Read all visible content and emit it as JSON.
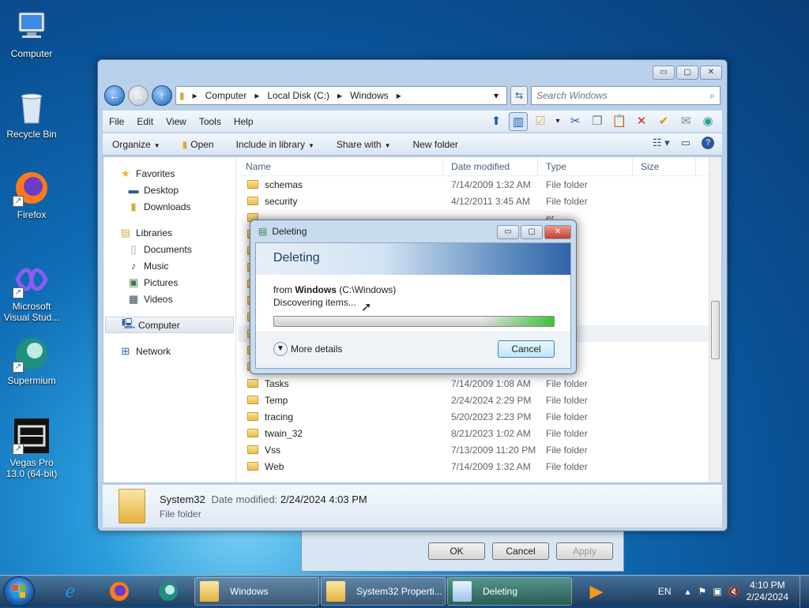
{
  "desktop": {
    "icons": [
      {
        "label": "Computer"
      },
      {
        "label": "Recycle Bin"
      },
      {
        "label": "Firefox"
      },
      {
        "label": "Microsoft Visual Stud..."
      },
      {
        "label": "Supermium"
      },
      {
        "label": "Vegas Pro 13.0 (64-bit)"
      }
    ]
  },
  "explorer": {
    "address": [
      "Computer",
      "Local Disk (C:)",
      "Windows"
    ],
    "search_placeholder": "Search Windows",
    "menu": [
      "File",
      "Edit",
      "View",
      "Tools",
      "Help"
    ],
    "commands": [
      "Organize",
      "Open",
      "Include in library",
      "Share with",
      "New folder"
    ],
    "nav": {
      "favorites": "Favorites",
      "fav_items": [
        "Desktop",
        "Downloads"
      ],
      "libraries": "Libraries",
      "lib_items": [
        "Documents",
        "Music",
        "Pictures",
        "Videos"
      ],
      "computer": "Computer",
      "network": "Network"
    },
    "columns": [
      "Name",
      "Date modified",
      "Type",
      "Size"
    ],
    "rows_top": [
      {
        "name": "schemas",
        "date": "7/14/2009 1:32 AM",
        "type": "File folder"
      },
      {
        "name": "security",
        "date": "4/12/2011 3:45 AM",
        "type": "File folder"
      }
    ],
    "rows_bottom": [
      {
        "name": "Tasks",
        "date": "7/14/2009 1:08 AM",
        "type": "File folder"
      },
      {
        "name": "Temp",
        "date": "2/24/2024 2:29 PM",
        "type": "File folder"
      },
      {
        "name": "tracing",
        "date": "5/20/2023 2:23 PM",
        "type": "File folder"
      },
      {
        "name": "twain_32",
        "date": "8/21/2023 1:02 AM",
        "type": "File folder"
      },
      {
        "name": "Vss",
        "date": "7/13/2009 11:20 PM",
        "type": "File folder"
      },
      {
        "name": "Web",
        "date": "7/14/2009 1:32 AM",
        "type": "File folder"
      }
    ],
    "hidden_type_col": "er",
    "details": {
      "name": "System32",
      "date_label": "Date modified:",
      "date": "2/24/2024 4:03 PM",
      "type": "File folder"
    }
  },
  "dialog": {
    "title": "Deleting",
    "heading": "Deleting",
    "from_label": "from",
    "from_bold": "Windows",
    "from_path": "(C:\\Windows)",
    "status": "Discovering items...",
    "more_details": "More details",
    "cancel": "Cancel"
  },
  "properties_buttons": {
    "ok": "OK",
    "cancel": "Cancel",
    "apply": "Apply"
  },
  "taskbar": {
    "tasks": [
      {
        "label": "Windows"
      },
      {
        "label": "System32 Properti..."
      },
      {
        "label": "Deleting"
      }
    ],
    "lang": "EN",
    "time": "4:10 PM",
    "date": "2/24/2024"
  }
}
